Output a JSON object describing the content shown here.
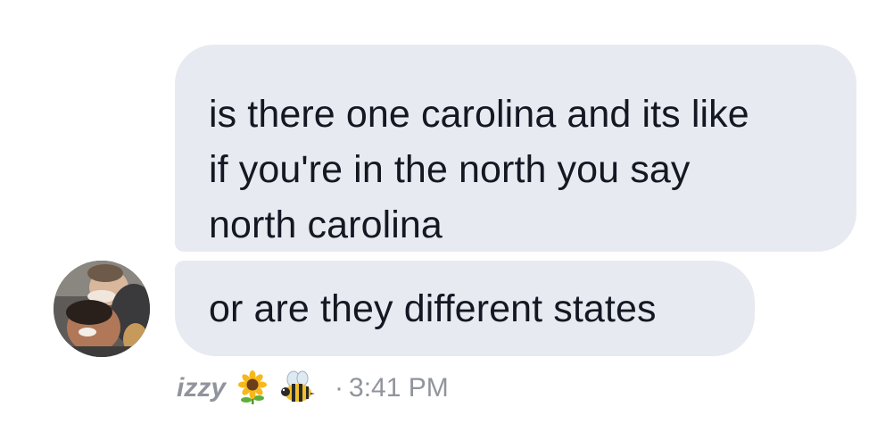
{
  "conversation": {
    "messages": [
      {
        "lines": [
          "is there one carolina and its like",
          "if you're in the north you say",
          "north carolina"
        ]
      },
      {
        "text": "or are they different states"
      }
    ],
    "meta": {
      "sender_name": "izzy",
      "sender_emojis": [
        "sunflower-icon",
        "bee-icon"
      ],
      "separator": "·",
      "time": "3:41 PM"
    }
  },
  "colors": {
    "bubble_background": "#e8eaf1",
    "message_text": "#141823",
    "meta_text": "#90949c",
    "page_background": "#ffffff"
  }
}
